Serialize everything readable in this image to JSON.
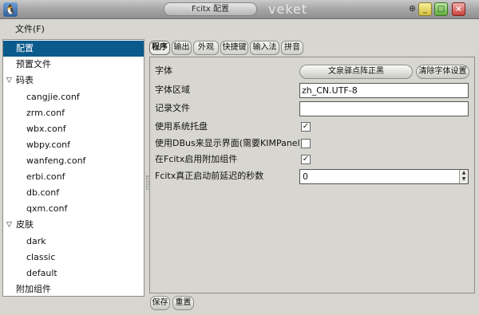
{
  "window": {
    "title": "Fcitx 配置",
    "brand": "veket",
    "app_icon": "penguin-icon",
    "menu_button": "⊕",
    "min_label": "_",
    "max_label": "□",
    "close_label": "×"
  },
  "menubar": {
    "file": "文件(F)"
  },
  "tree": {
    "items": [
      {
        "label": "配置",
        "selected": true,
        "arrow": ""
      },
      {
        "label": "预置文件",
        "arrow": ""
      },
      {
        "label": "码表",
        "arrow": "▽"
      },
      {
        "label": "cangjie.conf",
        "arrow": ""
      },
      {
        "label": "zrm.conf",
        "arrow": ""
      },
      {
        "label": "wbx.conf",
        "arrow": ""
      },
      {
        "label": "wbpy.conf",
        "arrow": ""
      },
      {
        "label": "wanfeng.conf",
        "arrow": ""
      },
      {
        "label": "erbi.conf",
        "arrow": ""
      },
      {
        "label": "db.conf",
        "arrow": ""
      },
      {
        "label": "qxm.conf",
        "arrow": ""
      },
      {
        "label": "皮肤",
        "arrow": "▽"
      },
      {
        "label": "dark",
        "arrow": ""
      },
      {
        "label": "classic",
        "arrow": ""
      },
      {
        "label": "default",
        "arrow": ""
      },
      {
        "label": "附加组件",
        "arrow": ""
      }
    ]
  },
  "tabs": [
    "程序",
    "输出",
    "外观",
    "快捷键",
    "输入法",
    "拼音"
  ],
  "settings": {
    "font_label": "字体",
    "font_button": "文泉驿点阵正黑",
    "clear_font_button": "清除字体设置",
    "locale_label": "字体区域",
    "locale_value": "zh_CN.UTF-8",
    "log_label": "记录文件",
    "log_value": "",
    "tray_label": "使用系统托盘",
    "tray_checked": "✓",
    "dbus_label": "使用DBus来显示界面(需要KIMPanel)",
    "dbus_checked": "",
    "addon_label": "在Fcitx启用附加组件",
    "addon_checked": "✓",
    "delay_label": "Fcitx真正启动前延迟的秒数",
    "delay_value": "0",
    "spin_up": "▲",
    "spin_down": "▼"
  },
  "footer": {
    "save": "保存",
    "reset": "重置"
  }
}
